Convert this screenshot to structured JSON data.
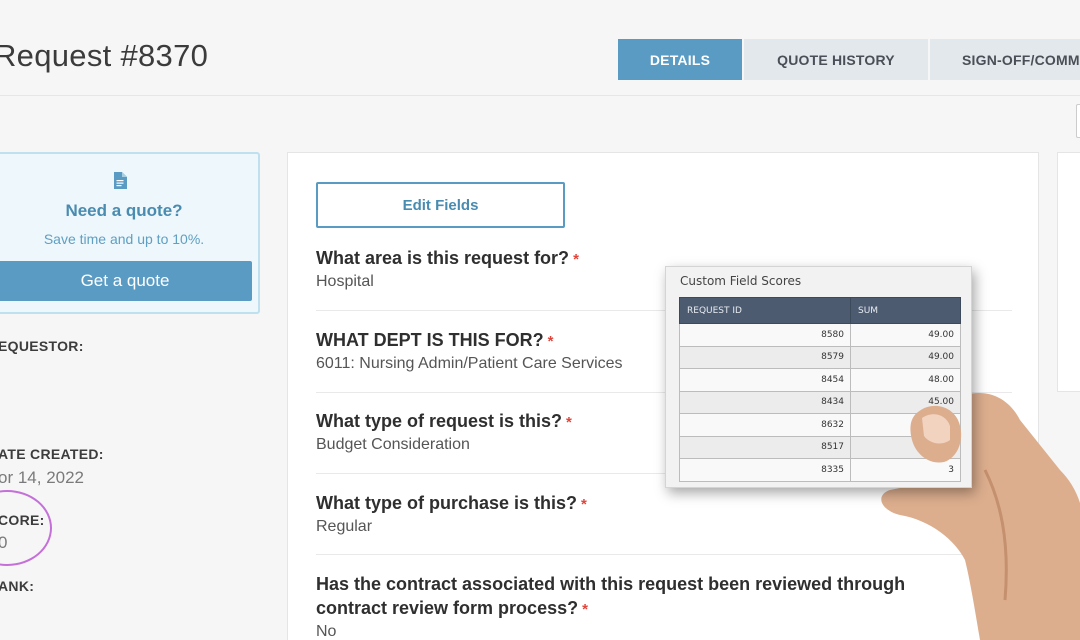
{
  "header": {
    "title": "Request #8370",
    "tabs": [
      {
        "label": "DETAILS",
        "active": true
      },
      {
        "label": "QUOTE HISTORY",
        "active": false
      },
      {
        "label": "SIGN-OFF/COMM",
        "active": false
      }
    ]
  },
  "quote_box": {
    "icon": "document-icon",
    "title": "Need a quote?",
    "subtitle": "Save time and up to 10%.",
    "button_label": "Get a quote"
  },
  "sidebar": {
    "requestor_label": "EQUESTOR:",
    "date_created_label": "ATE CREATED:",
    "date_created_value": "or 14, 2022",
    "score_label": "CORE:",
    "score_value": "0",
    "rank_label": "ANK:"
  },
  "main": {
    "edit_fields_label": "Edit Fields",
    "fields": [
      {
        "question": "What area is this request for?",
        "required_mark": "*",
        "answer": "Hospital"
      },
      {
        "question": "WHAT DEPT IS THIS FOR?",
        "required_mark": "*",
        "answer": "6011: Nursing Admin/Patient Care Services"
      },
      {
        "question": "What type of request is this?",
        "required_mark": "*",
        "answer": "Budget Consideration"
      },
      {
        "question": "What type of purchase is this?",
        "required_mark": "*",
        "answer": "Regular"
      },
      {
        "question_line1": "Has the contract associated with this request been reviewed through",
        "question_line2": "contract review form process?",
        "required_mark": "*",
        "answer": "No"
      }
    ]
  },
  "score_card": {
    "title": "Custom Field Scores",
    "columns": [
      "REQUEST ID",
      "SUM"
    ],
    "rows": [
      [
        "8580",
        "49.00"
      ],
      [
        "8579",
        "49.00"
      ],
      [
        "8454",
        "48.00"
      ],
      [
        "8434",
        "45.00"
      ],
      [
        "8632",
        ""
      ],
      [
        "8517",
        ""
      ],
      [
        "8335",
        "3"
      ]
    ]
  },
  "colors": {
    "accent": "#5a9bc4",
    "required": "#e0443a",
    "highlight_circle": "#c470d8",
    "table_header": "#4c5b70"
  }
}
